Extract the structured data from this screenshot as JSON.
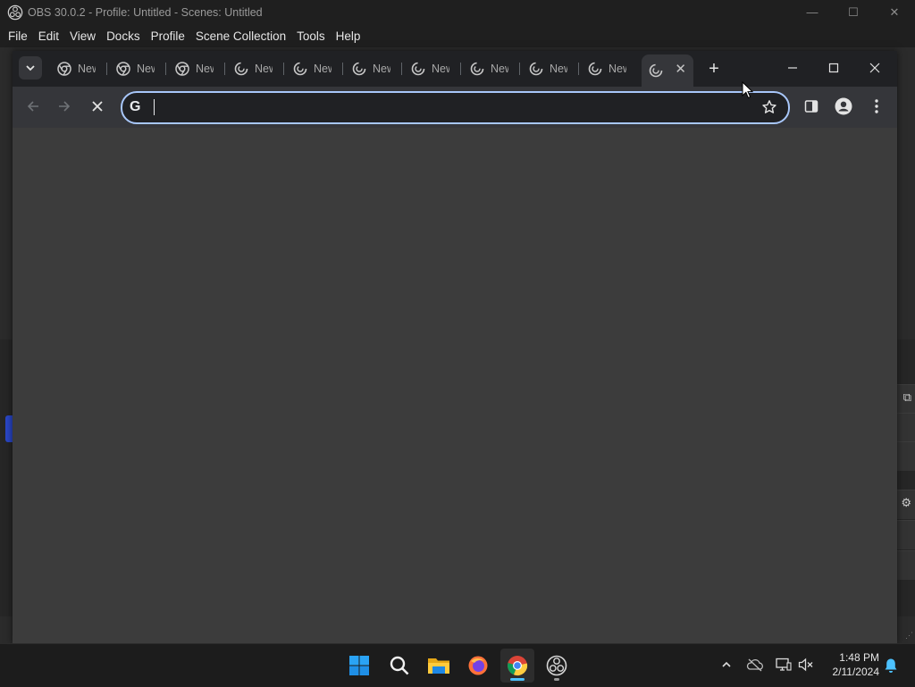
{
  "obs": {
    "title": "OBS 30.0.2 - Profile: Untitled - Scenes: Untitled",
    "menu": [
      "File",
      "Edit",
      "View",
      "Docks",
      "Profile",
      "Scene Collection",
      "Tools",
      "Help"
    ]
  },
  "chrome": {
    "tabs": [
      {
        "title": "New Tab",
        "icon": "chrome-icon"
      },
      {
        "title": "New Tab",
        "icon": "chrome-icon"
      },
      {
        "title": "New Tab",
        "icon": "chrome-icon"
      },
      {
        "title": "New Tab",
        "icon": "spinner-icon"
      },
      {
        "title": "New Tab",
        "icon": "spinner-icon"
      },
      {
        "title": "New Tab",
        "icon": "spinner-icon"
      },
      {
        "title": "New Tab",
        "icon": "spinner-icon"
      },
      {
        "title": "New Tab",
        "icon": "spinner-icon"
      },
      {
        "title": "New Tab",
        "icon": "spinner-icon"
      },
      {
        "title": "New Tab",
        "icon": "spinner-icon"
      }
    ],
    "active_tab": {
      "title": "",
      "icon": "spinner-icon",
      "close": "✕"
    },
    "new_tab": "+",
    "omnibox": {
      "value": "",
      "placeholder": "",
      "provider_icon": "G"
    },
    "accent": "#a8c7fa"
  },
  "taskbar": {
    "apps": [
      "windows-start-icon",
      "search-icon",
      "file-explorer-icon",
      "firefox-icon",
      "chrome-icon",
      "obs-icon"
    ],
    "time": "1:48 PM",
    "date": "2/11/2024"
  }
}
